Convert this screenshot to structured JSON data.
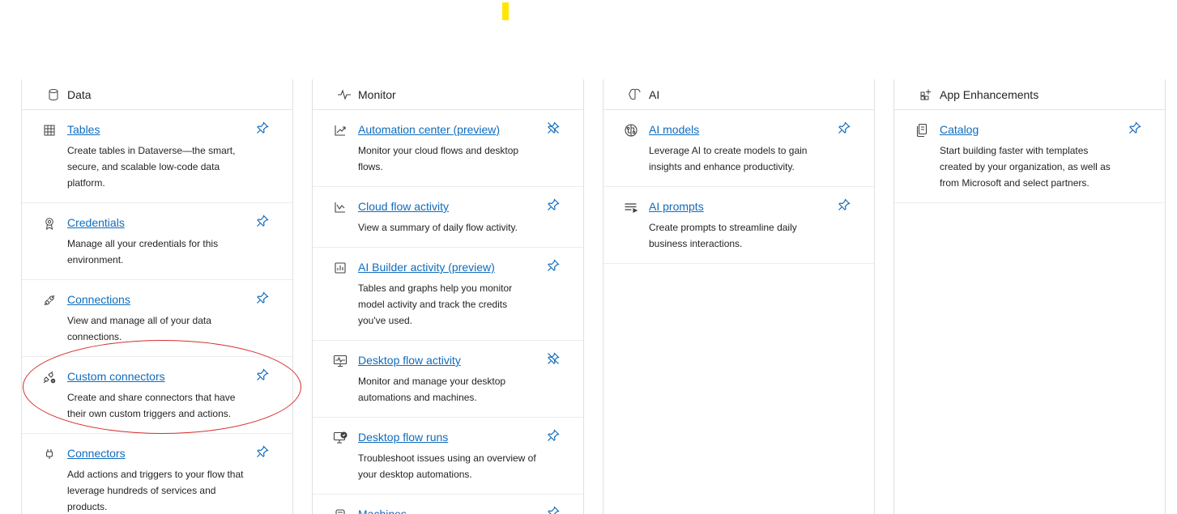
{
  "columns": [
    {
      "header": "Data",
      "header_icon": "database-icon",
      "items": [
        {
          "title": "Tables",
          "desc": "Create tables in Dataverse—the smart, secure, and scalable low-code data platform.",
          "icon": "table-icon",
          "pinned": false
        },
        {
          "title": "Credentials",
          "desc": "Manage all your credentials for this environment.",
          "icon": "credential-badge-icon",
          "pinned": false
        },
        {
          "title": "Connections",
          "desc": "View and manage all of your data connections.",
          "icon": "plug-connected-icon",
          "pinned": false
        },
        {
          "title": "Custom connectors",
          "desc": "Create and share connectors that have their own custom triggers and actions.",
          "icon": "plug-settings-icon",
          "pinned": false
        },
        {
          "title": "Connectors",
          "desc": "Add actions and triggers to your flow that leverage hundreds of services and products.",
          "icon": "plug-icon",
          "pinned": false
        }
      ]
    },
    {
      "header": "Monitor",
      "header_icon": "pulse-icon",
      "items": [
        {
          "title": "Automation center (preview)",
          "desc": "Monitor your cloud flows and desktop flows.",
          "icon": "trend-chart-icon",
          "pinned": true
        },
        {
          "title": "Cloud flow activity",
          "desc": "View a summary of daily flow activity.",
          "icon": "line-chart-icon",
          "pinned": false
        },
        {
          "title": "AI Builder activity (preview)",
          "desc": "Tables and graphs help you monitor model activity and track the credits you've used.",
          "icon": "bar-chart-icon",
          "pinned": false
        },
        {
          "title": "Desktop flow activity",
          "desc": "Monitor and manage your desktop automations and machines.",
          "icon": "desktop-pulse-icon",
          "pinned": true
        },
        {
          "title": "Desktop flow runs",
          "desc": "Troubleshoot issues using an overview of your desktop automations.",
          "icon": "desktop-check-icon",
          "pinned": false
        },
        {
          "title": "Machines",
          "desc": "",
          "icon": "machine-icon",
          "pinned": false
        }
      ]
    },
    {
      "header": "AI",
      "header_icon": "brain-icon",
      "items": [
        {
          "title": "AI models",
          "desc": "Leverage AI to create models to gain insights and enhance productivity.",
          "icon": "brain-circuit-icon",
          "pinned": false
        },
        {
          "title": "AI prompts",
          "desc": "Create prompts to streamline daily business interactions.",
          "icon": "prompt-icon",
          "pinned": false
        }
      ]
    },
    {
      "header": "App Enhancements",
      "header_icon": "apps-add-icon",
      "items": [
        {
          "title": "Catalog",
          "desc": "Start building faster with templates created by your organization, as well as from Microsoft and select partners.",
          "icon": "catalog-icon",
          "pinned": false
        }
      ]
    }
  ],
  "colors": {
    "link": "#0f6cbd",
    "pin": "#0f6cbd",
    "highlight": "#d32f2f",
    "marker": "#ffe600"
  }
}
